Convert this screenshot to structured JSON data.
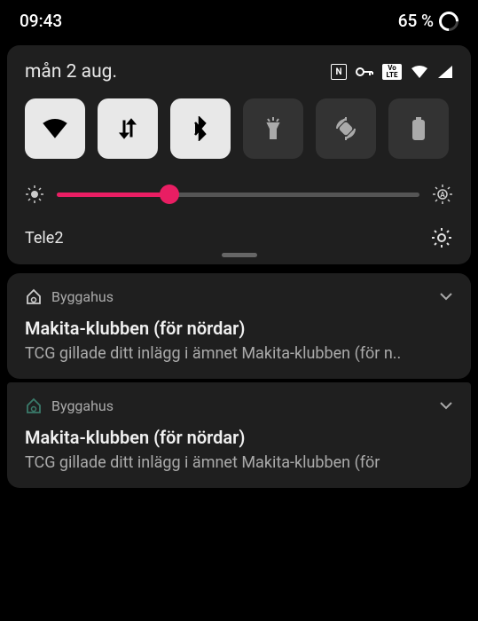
{
  "status": {
    "time": "09:43",
    "battery": "65 %"
  },
  "panel": {
    "date": "mån 2 aug.",
    "carrier": "Tele2",
    "brightness_pct": 31
  },
  "toggles": [
    {
      "name": "wifi-toggle",
      "icon": "wifi",
      "on": true
    },
    {
      "name": "data-toggle",
      "icon": "data",
      "on": true
    },
    {
      "name": "bluetooth-toggle",
      "icon": "bluetooth",
      "on": true
    },
    {
      "name": "flashlight-toggle",
      "icon": "flashlight",
      "on": false
    },
    {
      "name": "rotate-toggle",
      "icon": "rotate",
      "on": false
    },
    {
      "name": "battery-saver-toggle",
      "icon": "battery",
      "on": false
    }
  ],
  "notifications": [
    {
      "app": "Byggahus",
      "title": "Makita-klubben (för nördar)",
      "body": "TCG gillade ditt inlägg i ämnet Makita-klubben (för n.."
    },
    {
      "app": "Byggahus",
      "title": "Makita-klubben (för nördar)",
      "body": "TCG gillade ditt inlägg i ämnet Makita-klubben (för"
    }
  ]
}
